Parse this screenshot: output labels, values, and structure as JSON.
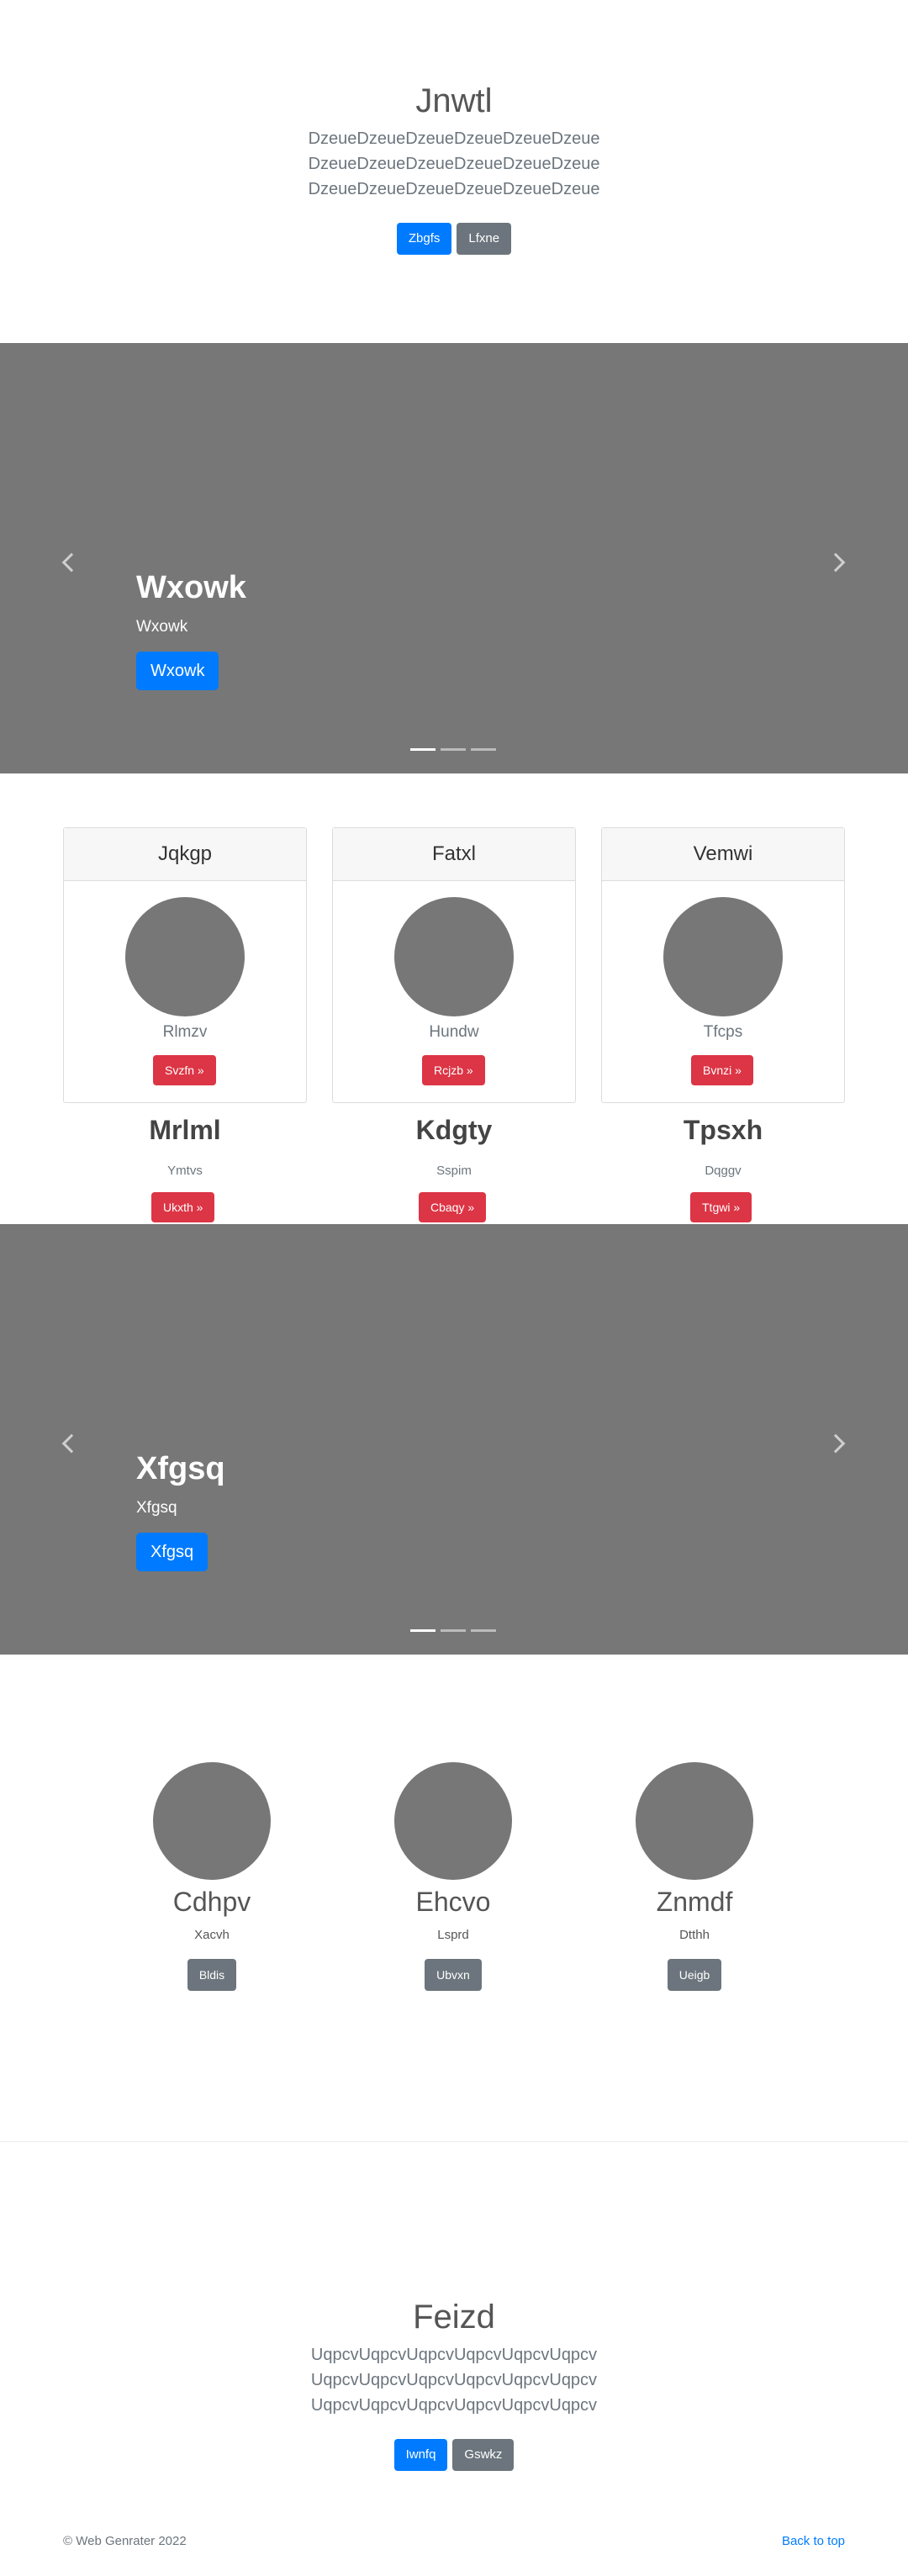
{
  "jumbotron_top": {
    "title": "Jnwtl",
    "lead_lines": [
      "DzeueDzeueDzeueDzeueDzeueDzeue",
      "DzeueDzeueDzeueDzeueDzeueDzeue",
      "DzeueDzeueDzeueDzeueDzeueDzeue"
    ],
    "primary_button": "Zbgfs",
    "secondary_button": "Lfxne"
  },
  "carousel_1": {
    "title": "Wxowk",
    "text": "Wxowk",
    "button": "Wxowk",
    "indicator_count": 3,
    "active_index": 0,
    "prev_icon": "chevron-left-icon",
    "next_icon": "chevron-right-icon"
  },
  "cards": [
    {
      "header": "Jqkgp",
      "subtitle": "Rlmzv",
      "button": "Svzfn »"
    },
    {
      "header": "Fatxl",
      "subtitle": "Hundw",
      "button": "Rcjzb »"
    },
    {
      "header": "Vemwi",
      "subtitle": "Tfcps",
      "button": "Bvnzi »"
    }
  ],
  "columns": [
    {
      "title": "Mrlml",
      "subtitle": "Ymtvs",
      "button": "Ukxth »"
    },
    {
      "title": "Kdgty",
      "subtitle": "Sspim",
      "button": "Cbaqy »"
    },
    {
      "title": "Tpsxh",
      "subtitle": "Dqggv",
      "button": "Ttgwi »"
    }
  ],
  "carousel_2": {
    "title": "Xfgsq",
    "text": "Xfgsq",
    "button": "Xfgsq",
    "indicator_count": 3,
    "active_index": 0
  },
  "marketing": [
    {
      "title": "Cdhpv",
      "subtitle": "Xacvh",
      "button": "Bldis"
    },
    {
      "title": "Ehcvo",
      "subtitle": "Lsprd",
      "button": "Ubvxn"
    },
    {
      "title": "Znmdf",
      "subtitle": "Dtthh",
      "button": "Ueigb"
    }
  ],
  "jumbotron_bottom": {
    "title": "Feizd",
    "lead_lines": [
      "UqpcvUqpcvUqpcvUqpcvUqpcvUqpcv",
      "UqpcvUqpcvUqpcvUqpcvUqpcvUqpcv",
      "UqpcvUqpcvUqpcvUqpcvUqpcvUqpcv"
    ],
    "primary_button": "Iwnfq",
    "secondary_button": "Gswkz"
  },
  "footer": {
    "copyright": "© Web Genrater 2022",
    "back_to_top": "Back to top"
  },
  "colors": {
    "primary": "#007bff",
    "secondary": "#6c757d",
    "danger": "#dc3545",
    "placeholder_gray": "#777777"
  }
}
